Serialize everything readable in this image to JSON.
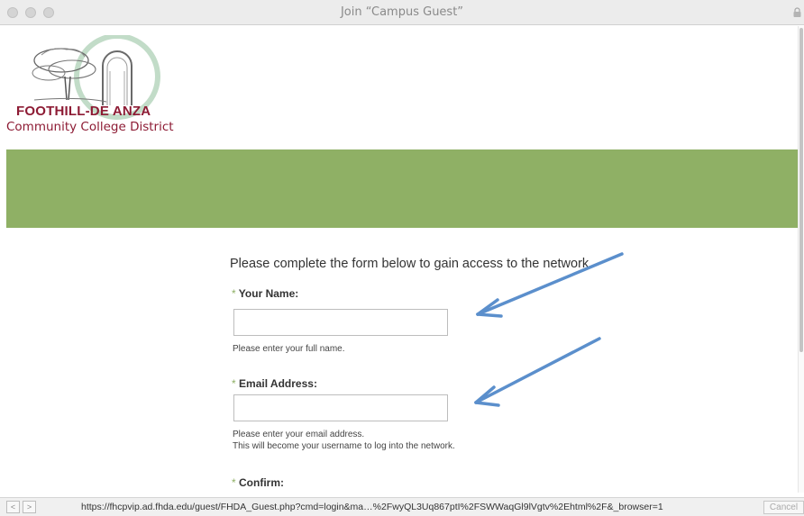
{
  "window": {
    "title": "Join “Campus Guest”"
  },
  "logo": {
    "line1": "FOOTHILL-DE ANZA",
    "line2": "Community College District"
  },
  "form": {
    "intro": "Please complete the form below to gain access to the network.",
    "required_mark": "*",
    "name_label": "Your Name:",
    "name_value": "",
    "name_help": "Please enter your full name.",
    "email_label": "Email Address:",
    "email_value": "",
    "email_help_1": "Please enter your email address.",
    "email_help_2": "This will become your username to log into the network.",
    "confirm_label": "Confirm:"
  },
  "statusbar": {
    "url": "https://fhcpvip.ad.fhda.edu/guest/FHDA_Guest.php?cmd=login&ma…%2FwyQL3Uq867ptI%2FSWWaqGl9lVgtv%2Ehtml%2F&_browser=1",
    "back": "<",
    "forward": ">",
    "cancel_label": "Cancel"
  },
  "colors": {
    "banner": "#8fb065",
    "brand": "#8d1b34",
    "arrow": "#5b8fcc"
  }
}
